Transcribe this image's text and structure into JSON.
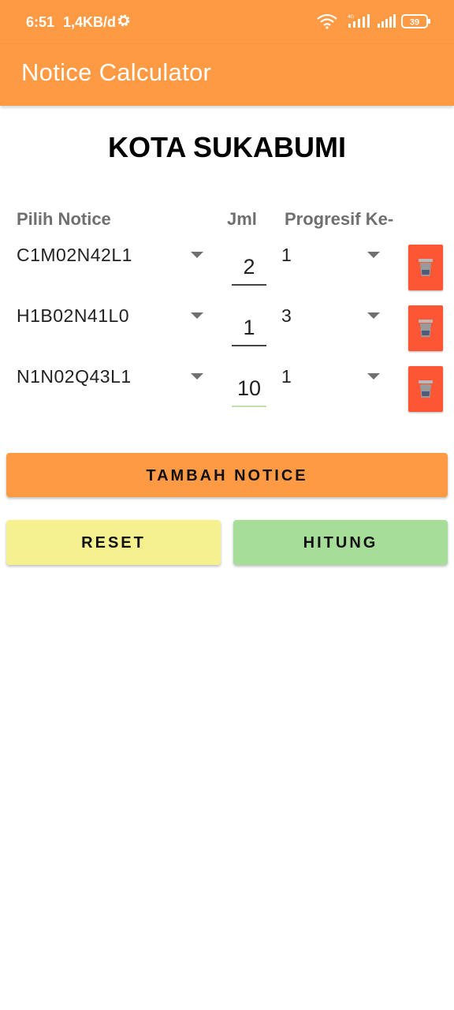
{
  "status": {
    "time": "6:51",
    "net_speed": "1,4KB/d",
    "battery": "39"
  },
  "appbar": {
    "title": "Notice Calculator"
  },
  "city": "KOTA SUKABUMI",
  "headers": {
    "notice": "Pilih Notice",
    "jml": "Jml",
    "progresif": "Progresif Ke-"
  },
  "rows": [
    {
      "notice": "C1M02N42L1",
      "jml": "2",
      "progresif": "1"
    },
    {
      "notice": "H1B02N41L0",
      "jml": "1",
      "progresif": "3"
    },
    {
      "notice": "N1N02Q43L1",
      "jml": "10",
      "progresif": "1"
    }
  ],
  "buttons": {
    "add": "TAMBAH NOTICE",
    "reset": "RESET",
    "calc": "HITUNG"
  },
  "colors": {
    "accent": "#fe9a44",
    "delete": "#fd5634",
    "reset": "#f6f18f",
    "calc": "#a6de99"
  },
  "icons": [
    "settings-gear-icon",
    "wifi-icon",
    "signal-icon",
    "battery-icon",
    "dropdown-arrow-icon",
    "trash-icon"
  ]
}
